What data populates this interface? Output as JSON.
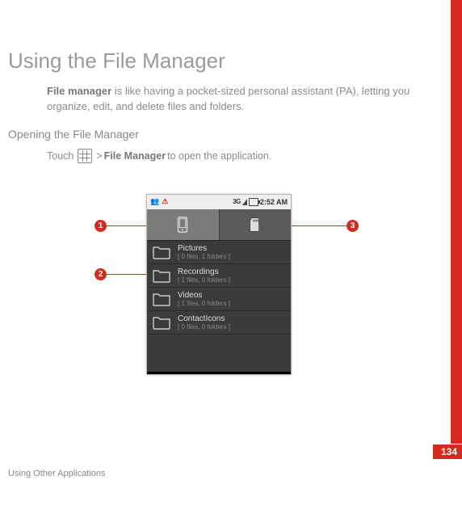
{
  "heading": "Using the File Manager",
  "intro": {
    "bold": "File manager",
    "rest": " is like having a pocket-sized personal assistant (PA), letting you organize, edit, and delete files and folders."
  },
  "subheading": "Opening the File Manager",
  "touch_line": {
    "prefix": "Touch ",
    "mid": " > ",
    "bold": "File Manager",
    "suffix": " to open the application."
  },
  "statusbar": {
    "time": "2:52 AM",
    "net": "3G"
  },
  "folders": [
    {
      "name": "Pictures",
      "sub": "[ 0 files, 1 folders  ]"
    },
    {
      "name": "Recordings",
      "sub": "[ 1 files, 0 folders  ]"
    },
    {
      "name": "Videos",
      "sub": "[ 1 files, 0 folders  ]"
    },
    {
      "name": "ContactIcons",
      "sub": "[ 0 files, 0 folders  ]"
    }
  ],
  "callouts": {
    "c1": "1",
    "c2": "2",
    "c3": "3"
  },
  "page_number": "134",
  "footer": "Using Other Applications"
}
